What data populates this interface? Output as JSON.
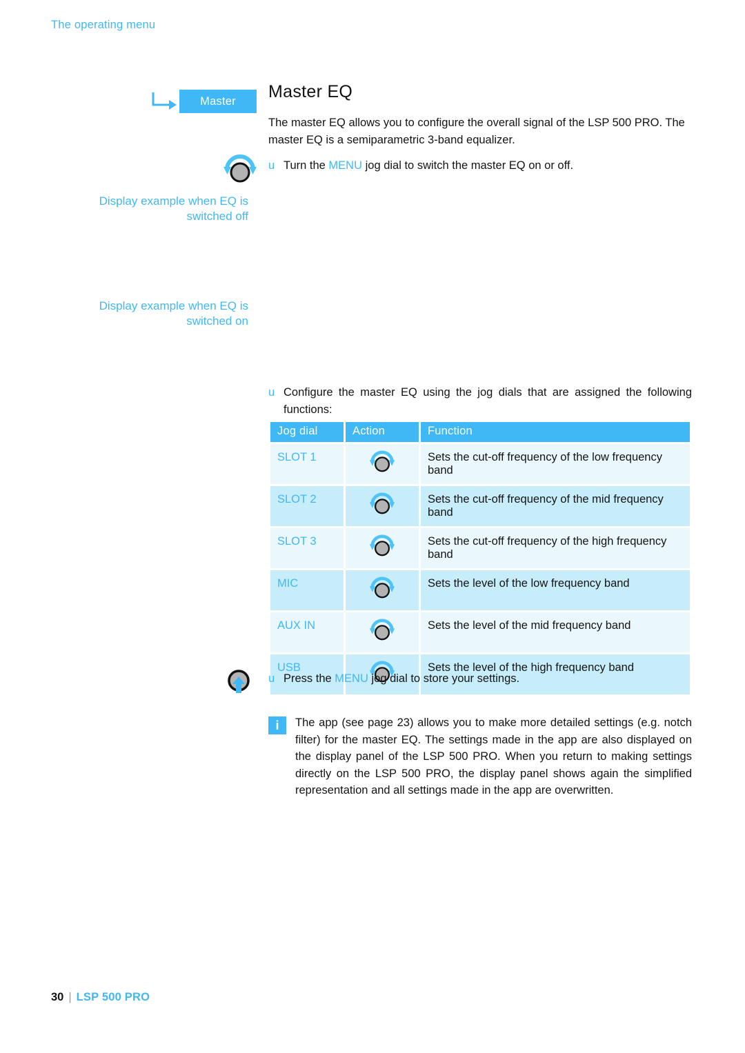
{
  "header": {
    "running_title": "The operating menu"
  },
  "colors": {
    "accent_blue": "#3fb8f5",
    "row_light": "#eaf8fe",
    "row_dark": "#c7ecfa",
    "body_text": "#141414"
  },
  "margin_notes": {
    "eq_off": "Display example when EQ is switched off",
    "eq_on": "Display example when EQ is switched on"
  },
  "master_tag": {
    "label": "Master",
    "arrow_icon": "elbow-arrow-icon"
  },
  "main": {
    "title": "Master EQ",
    "intro_paragraph": "The master EQ allows you to configure the overall signal of the LSP 500 PRO. The master EQ is a semiparametric 3-band equalizer.",
    "steps": [
      {
        "bullet": "u",
        "icon": "jog-dial-turn-icon",
        "text_before": "Turn the ",
        "accent": "MENU",
        "text_after": " jog dial to switch the master EQ on or off."
      },
      {
        "bullet": "u",
        "text_full": "Configure the master EQ using the jog dials that are assigned the following functions:"
      },
      {
        "bullet": "u",
        "icon": "jog-dial-press-icon",
        "text_before": "Press the ",
        "accent": "MENU",
        "text_after": " jog dial to store your settings."
      }
    ],
    "table": {
      "columns": [
        "Jog dial",
        "Action",
        "Function"
      ],
      "rows": [
        {
          "jog_dial": "SLOT 1",
          "action_icon": "jog-dial-turn-icon",
          "function": "Sets the cut-off frequency of the low frequency band"
        },
        {
          "jog_dial": "SLOT 2",
          "action_icon": "jog-dial-turn-icon",
          "function": "Sets the cut-off frequency of the mid frequency band"
        },
        {
          "jog_dial": "SLOT 3",
          "action_icon": "jog-dial-turn-icon",
          "function": "Sets the cut-off frequency of the high frequency band"
        },
        {
          "jog_dial": "MIC",
          "action_icon": "jog-dial-turn-icon",
          "function": "Sets the level of the low frequency band"
        },
        {
          "jog_dial": "AUX IN",
          "action_icon": "jog-dial-turn-icon",
          "function": "Sets the level of the mid frequency band"
        },
        {
          "jog_dial": "USB",
          "action_icon": "jog-dial-turn-icon",
          "function": "Sets the level of the high frequency band"
        }
      ]
    },
    "info_note": {
      "icon": "info-icon",
      "icon_glyph": "i",
      "text": "The app (see page 23) allows you to make more detailed settings (e.g. notch filter) for the master EQ. The settings made in the app are also displayed on the display panel of the LSP 500 PRO. When you return to making settings directly on the LSP 500 PRO, the display panel shows again the simplified representation and all settings made in the app are overwritten."
    }
  },
  "footer": {
    "page_number": "30",
    "separator": "|",
    "product": "LSP 500 PRO"
  }
}
